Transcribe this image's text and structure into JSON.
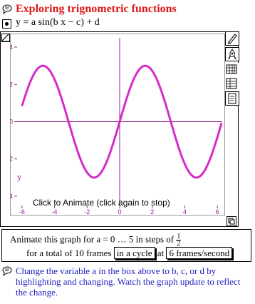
{
  "header": {
    "title": "Exploring trignometric functions"
  },
  "equation": {
    "text": "y = a sin(b x − c) + d"
  },
  "graph": {
    "x_axis_label": "x",
    "y_axis_label": "y",
    "animate_caption": "Click to Animate (click again to stop)",
    "x_ticks": [
      "-6",
      "-4",
      "-2",
      "0",
      "2",
      "4",
      "6"
    ],
    "y_ticks": [
      "4",
      "2",
      "0",
      "-2",
      "-4"
    ],
    "curve_color": "#d62bc9"
  },
  "chart_data": {
    "type": "line",
    "function": "y = 3 sin(x)",
    "xlim": [
      -6.3,
      6.3
    ],
    "ylim": [
      -4.5,
      4.5
    ],
    "x_ticks": [
      -6,
      -4,
      -2,
      0,
      2,
      4,
      6
    ],
    "y_ticks": [
      4,
      2,
      0,
      -2,
      -4
    ],
    "series": [
      {
        "x": [
          -6.0,
          -5.0,
          -4.71,
          -4.0,
          -3.14,
          -2.0,
          -1.57,
          -1.0,
          0.0,
          1.0,
          1.57,
          2.0,
          3.14,
          4.0,
          4.71,
          5.0,
          6.0
        ],
        "y": [
          0.84,
          2.88,
          3.0,
          2.27,
          0.0,
          -2.73,
          -3.0,
          -2.52,
          0.0,
          2.52,
          3.0,
          2.73,
          0.0,
          -2.27,
          -3.0,
          -2.88,
          -0.84
        ]
      }
    ]
  },
  "animate_panel": {
    "line1_prefix": "Animate this graph for",
    "variable": "a",
    "line1_range": "= 0 … 5 in steps of",
    "step_num": "1",
    "step_den": "2",
    "line2_prefix": "for a total of 10 frames",
    "cycle_option": "in a cycle",
    "at_label": "at",
    "rate_option": "6 frames/second"
  },
  "note": {
    "text": "Change the variable a  in the box above to b, c, or d by highlighting and changing. Watch the graph update to reflect the change."
  },
  "toolbar": {
    "icons": [
      "pencil-icon",
      "rocket-icon",
      "grid-icon",
      "table-icon",
      "document-icon",
      "pane-resize-icon"
    ]
  }
}
